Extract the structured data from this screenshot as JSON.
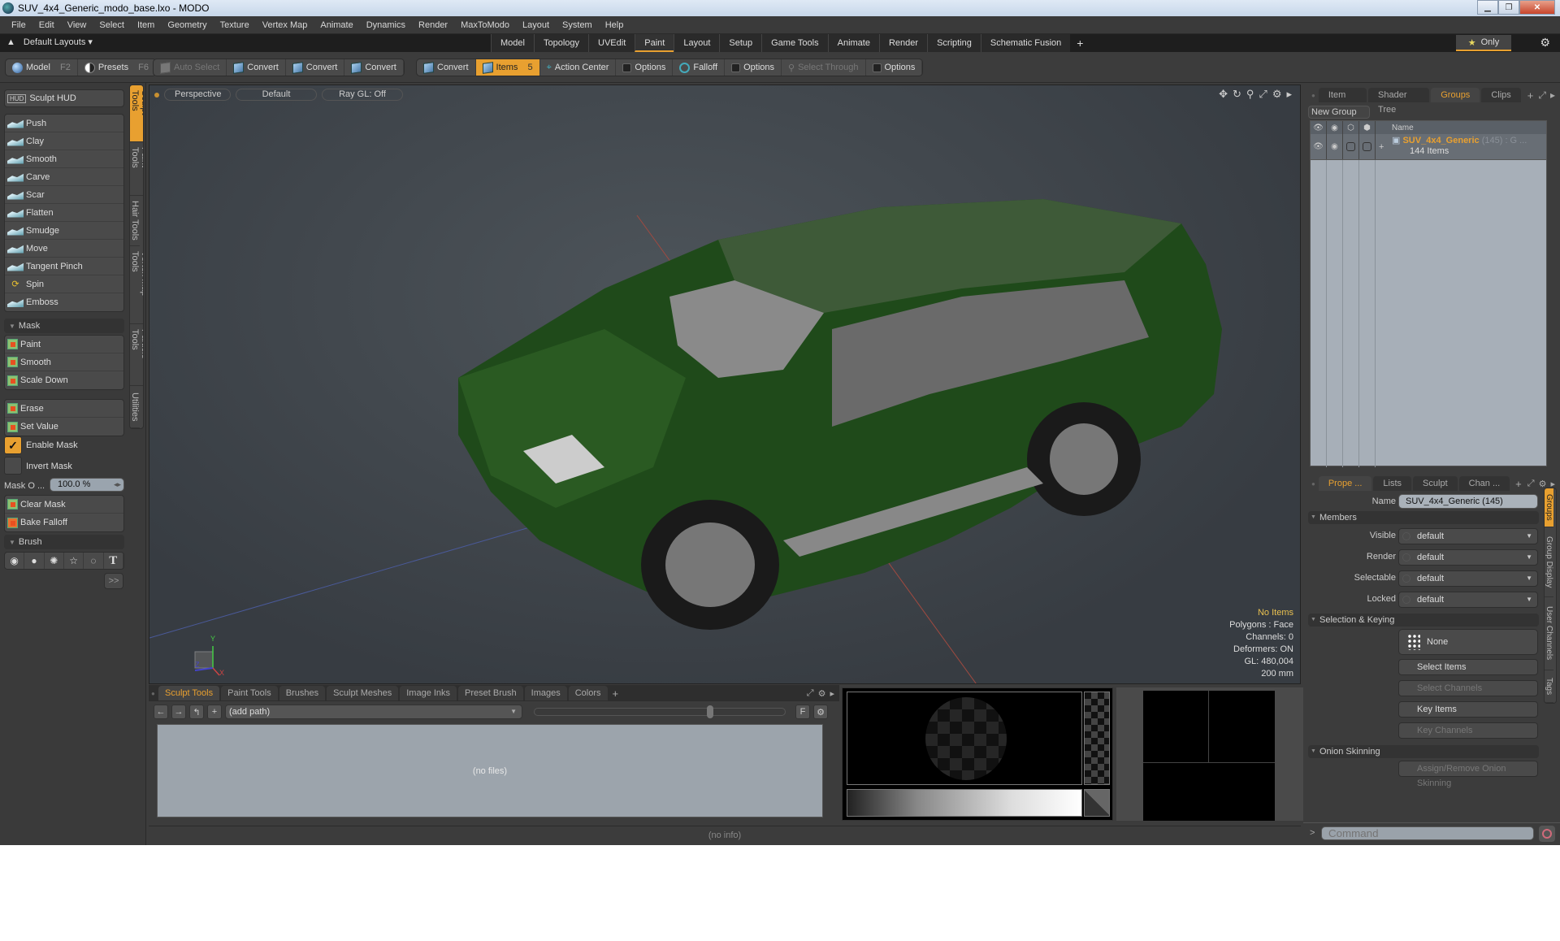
{
  "window": {
    "title": "SUV_4x4_Generic_modo_base.lxo - MODO",
    "controls": [
      "minimize",
      "restore",
      "close"
    ]
  },
  "menu": [
    "File",
    "Edit",
    "View",
    "Select",
    "Item",
    "Geometry",
    "Texture",
    "Vertex Map",
    "Animate",
    "Dynamics",
    "Render",
    "MaxToModo",
    "Layout",
    "System",
    "Help"
  ],
  "layoutbar": {
    "layouts_label": "Default Layouts",
    "tabs": [
      "Model",
      "Topology",
      "UVEdit",
      "Paint",
      "Layout",
      "Setup",
      "Game Tools",
      "Animate",
      "Render",
      "Scripting",
      "Schematic Fusion"
    ],
    "active_tab": "Paint",
    "only_label": "Only"
  },
  "toolbar": {
    "model": {
      "label": "Model",
      "key": "F2"
    },
    "presets": {
      "label": "Presets",
      "key": "F6"
    },
    "auto_select": "Auto Select",
    "convert1": "Convert",
    "convert2": "Convert",
    "convert3": "Convert",
    "convert4": "Convert",
    "items": {
      "label": "Items",
      "count": "5"
    },
    "action_center": "Action Center",
    "options1": "Options",
    "falloff": "Falloff",
    "options2": "Options",
    "select_through": "Select Through",
    "options3": "Options"
  },
  "sculpt": {
    "hud_label": "Sculpt HUD",
    "tools": [
      "Push",
      "Clay",
      "Smooth",
      "Carve",
      "Scar",
      "Flatten",
      "Smudge",
      "Move",
      "Tangent Pinch",
      "Spin",
      "Emboss"
    ],
    "mask_header": "Mask",
    "mask_tools": [
      "Paint",
      "Smooth",
      "Scale Down"
    ],
    "mask_tools2": [
      "Erase",
      "Set Value"
    ],
    "enable_mask": "Enable Mask",
    "enable_mask_checked": true,
    "invert_mask": "Invert Mask",
    "invert_mask_checked": false,
    "mask_opacity_label": "Mask O ...",
    "mask_opacity_value": "100.0 %",
    "clear_mask": "Clear Mask",
    "bake_falloff": "Bake Falloff",
    "brush_header": "Brush",
    "more_label": ">>",
    "vtabs": [
      "Sculpt Tools",
      "Paint Tools",
      "Hair Tools",
      "Vertex Map Tools",
      "Particle Tools",
      "Utilities"
    ],
    "active_vtab": "Sculpt Tools"
  },
  "viewport": {
    "view": "Perspective",
    "shading": "Default",
    "raygl": "Ray GL: Off",
    "info": {
      "items": "No Items",
      "polygons": "Polygons : Face",
      "channels": "Channels: 0",
      "deformers": "Deformers: ON",
      "gl": "GL: 480,004",
      "scale": "200 mm"
    },
    "axis": {
      "x": "X",
      "y": "Y",
      "z": "Z"
    }
  },
  "bottom": {
    "tabs": [
      "Sculpt Tools",
      "Paint Tools",
      "Brushes",
      "Sculpt Meshes",
      "Image Inks",
      "Preset Brush",
      "Images",
      "Colors"
    ],
    "active_tab": "Sculpt Tools",
    "path_placeholder": "(add path)",
    "f_label": "F",
    "no_files": "(no files)",
    "status": "(no info)"
  },
  "groups": {
    "tabs": [
      "Item List",
      "Shader Tree",
      "Groups",
      "Clips"
    ],
    "active_tab": "Groups",
    "new_group": "New Group",
    "column_name": "Name",
    "rows": [
      {
        "name": "SUV_4x4_Generic",
        "count": "(145) : G ...",
        "sub": "144 Items"
      }
    ]
  },
  "properties": {
    "tabs": [
      "Prope ...",
      "Lists",
      "Sculpt",
      "Chan ..."
    ],
    "active_tab": "Prope ...",
    "name_label": "Name",
    "name_value": "SUV_4x4_Generic (145)",
    "members_header": "Members",
    "fields": [
      {
        "label": "Visible",
        "value": "default"
      },
      {
        "label": "Render",
        "value": "default"
      },
      {
        "label": "Selectable",
        "value": "default"
      },
      {
        "label": "Locked",
        "value": "default"
      }
    ],
    "selection_header": "Selection & Keying",
    "none_label": "None",
    "select_items": "Select Items",
    "select_channels": "Select Channels",
    "key_items": "Key Items",
    "key_channels": "Key Channels",
    "onion_header": "Onion Skinning",
    "onion_button": "Assign/Remove Onion Skinning",
    "vtabs": [
      "Groups",
      "Group Display",
      "User Channels",
      "Tags"
    ],
    "active_vtab": "Groups"
  },
  "command": {
    "prompt": ">",
    "placeholder": "Command"
  },
  "colors": {
    "accent": "#e8a030",
    "car_body": "#1e4a1a",
    "viewport_bg": "#41474d"
  }
}
